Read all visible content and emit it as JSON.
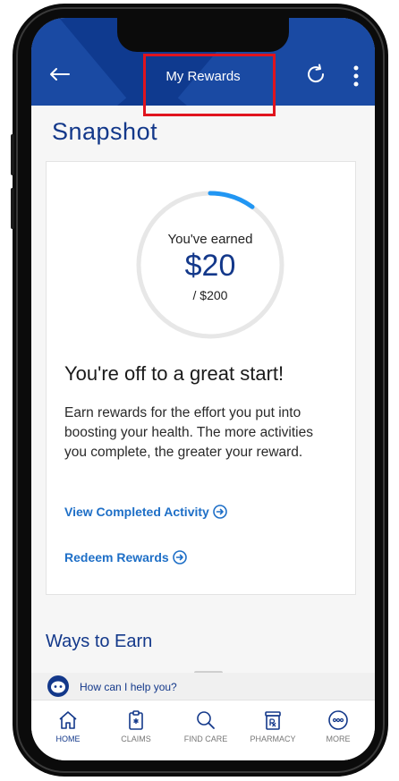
{
  "header": {
    "title": "My Rewards"
  },
  "page": {
    "title": "Snapshot"
  },
  "rewards": {
    "earned_label": "You've earned",
    "earned_amount": "$20",
    "total": "/ $200",
    "progress": 0.1,
    "headline": "You're off to a great start!",
    "description": "Earn rewards for the effort you put into boosting your health. The more activities you complete, the greater your reward.",
    "view_link": "View Completed Activity",
    "redeem_link": "Redeem Rewards"
  },
  "ways": {
    "title": "Ways to Earn"
  },
  "help": {
    "text": "How can I help you?"
  },
  "nav": {
    "items": [
      {
        "label": "HOME",
        "icon": "home-icon",
        "active": true
      },
      {
        "label": "CLAIMS",
        "icon": "claims-icon",
        "active": false
      },
      {
        "label": "FIND CARE",
        "icon": "search-icon",
        "active": false
      },
      {
        "label": "PHARMACY",
        "icon": "pharmacy-icon",
        "active": false
      },
      {
        "label": "MORE",
        "icon": "more-icon",
        "active": false
      }
    ]
  },
  "colors": {
    "brand": "#13388a",
    "header": "#0f3a8f",
    "accent": "#2196f3",
    "link": "#1e6fc7",
    "highlight": "#e0141e"
  }
}
